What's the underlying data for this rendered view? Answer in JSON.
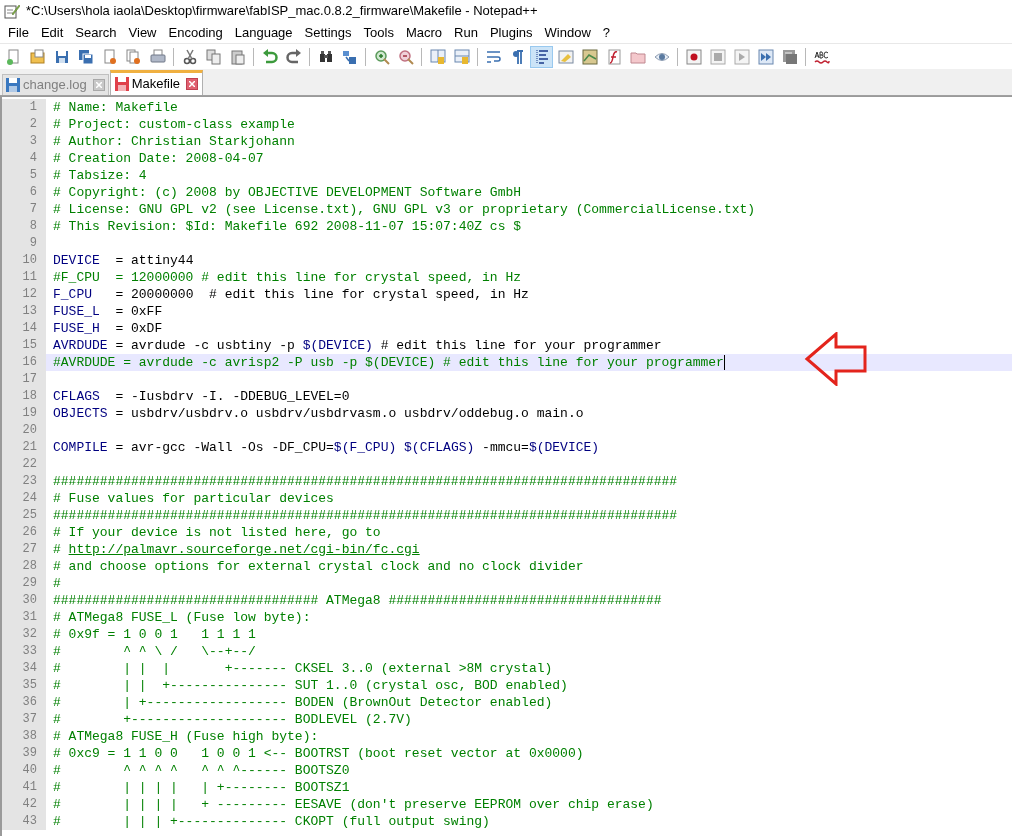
{
  "window": {
    "title": "*C:\\Users\\hola iaola\\Desktop\\firmware\\fabISP_mac.0.8.2_firmware\\Makefile - Notepad++"
  },
  "menu": [
    "File",
    "Edit",
    "Search",
    "View",
    "Encoding",
    "Language",
    "Settings",
    "Tools",
    "Macro",
    "Run",
    "Plugins",
    "Window",
    "?"
  ],
  "toolbar": [
    {
      "kind": "new",
      "selected": false
    },
    {
      "kind": "open",
      "selected": false
    },
    {
      "kind": "save",
      "selected": false
    },
    {
      "kind": "save-all",
      "selected": false
    },
    {
      "kind": "close",
      "selected": false
    },
    {
      "kind": "close-all",
      "selected": false
    },
    {
      "kind": "print",
      "selected": false
    },
    {
      "kind": "separator"
    },
    {
      "kind": "cut",
      "selected": false
    },
    {
      "kind": "copy",
      "selected": false
    },
    {
      "kind": "paste",
      "selected": false
    },
    {
      "kind": "separator"
    },
    {
      "kind": "undo",
      "selected": false
    },
    {
      "kind": "redo",
      "selected": false
    },
    {
      "kind": "separator"
    },
    {
      "kind": "find",
      "selected": false
    },
    {
      "kind": "replace",
      "selected": false
    },
    {
      "kind": "separator"
    },
    {
      "kind": "zoom-in",
      "selected": false
    },
    {
      "kind": "zoom-out",
      "selected": false
    },
    {
      "kind": "separator"
    },
    {
      "kind": "sync-vertical",
      "selected": false
    },
    {
      "kind": "sync-horizontal",
      "selected": false
    },
    {
      "kind": "separator"
    },
    {
      "kind": "wrap",
      "selected": false
    },
    {
      "kind": "pilcrow",
      "selected": false
    },
    {
      "kind": "indent-guide",
      "selected": true
    },
    {
      "kind": "language",
      "selected": false
    },
    {
      "kind": "map",
      "selected": false
    },
    {
      "kind": "function",
      "selected": false
    },
    {
      "kind": "folder",
      "selected": false
    },
    {
      "kind": "eye",
      "selected": false
    },
    {
      "kind": "separator"
    },
    {
      "kind": "record",
      "selected": false
    },
    {
      "kind": "stop",
      "selected": false
    },
    {
      "kind": "play",
      "selected": false
    },
    {
      "kind": "play-multiple",
      "selected": false
    },
    {
      "kind": "save-macro",
      "selected": false
    },
    {
      "kind": "separator"
    },
    {
      "kind": "spellcheck",
      "selected": false
    }
  ],
  "tabs": [
    {
      "label": "change.log",
      "selected": false,
      "modified": false
    },
    {
      "label": "Makefile",
      "selected": true,
      "modified": true
    }
  ],
  "editor": {
    "lines": [
      {
        "number": "1",
        "current": false,
        "segments": [
          {
            "kind": "comment",
            "text": "# Name: Makefile"
          }
        ]
      },
      {
        "number": "2",
        "current": false,
        "segments": [
          {
            "kind": "comment",
            "text": "# Project: custom-class example"
          }
        ]
      },
      {
        "number": "3",
        "current": false,
        "segments": [
          {
            "kind": "comment",
            "text": "# Author: Christian Starkjohann"
          }
        ]
      },
      {
        "number": "4",
        "current": false,
        "segments": [
          {
            "kind": "comment",
            "text": "# Creation Date: 2008-04-07"
          }
        ]
      },
      {
        "number": "5",
        "current": false,
        "segments": [
          {
            "kind": "comment",
            "text": "# Tabsize: 4"
          }
        ]
      },
      {
        "number": "6",
        "current": false,
        "segments": [
          {
            "kind": "comment",
            "text": "# Copyright: (c) 2008 by OBJECTIVE DEVELOPMENT Software GmbH"
          }
        ]
      },
      {
        "number": "7",
        "current": false,
        "segments": [
          {
            "kind": "comment",
            "text": "# License: GNU GPL v2 (see License.txt), GNU GPL v3 or proprietary (CommercialLicense.txt)"
          }
        ]
      },
      {
        "number": "8",
        "current": false,
        "segments": [
          {
            "kind": "comment",
            "text": "# This Revision: $Id: Makefile 692 2008-11-07 15:07:40Z cs $"
          }
        ]
      },
      {
        "number": "9",
        "current": false
      },
      {
        "number": "10",
        "current": false,
        "segments": [
          {
            "kind": "variable",
            "text": "DEVICE"
          },
          {
            "kind": "plain",
            "text": "  = attiny44"
          }
        ]
      },
      {
        "number": "11",
        "current": false,
        "segments": [
          {
            "kind": "comment",
            "text": "#F_CPU  = 12000000 # edit this line for crystal speed, in Hz"
          }
        ]
      },
      {
        "number": "12",
        "current": false,
        "segments": [
          {
            "kind": "variable",
            "text": "F_CPU"
          },
          {
            "kind": "plain",
            "text": "   = 20000000  # edit this line for crystal speed, in Hz"
          }
        ]
      },
      {
        "number": "13",
        "current": false,
        "segments": [
          {
            "kind": "variable",
            "text": "FUSE_L"
          },
          {
            "kind": "plain",
            "text": "  = 0xFF"
          }
        ]
      },
      {
        "number": "14",
        "current": false,
        "segments": [
          {
            "kind": "variable",
            "text": "FUSE_H"
          },
          {
            "kind": "plain",
            "text": "  = 0xDF"
          }
        ]
      },
      {
        "number": "15",
        "current": false,
        "segments": [
          {
            "kind": "variable",
            "text": "AVRDUDE"
          },
          {
            "kind": "plain",
            "text": " = avrdude -c usbtiny -p "
          },
          {
            "kind": "variable",
            "text": "$(DEVICE)"
          },
          {
            "kind": "plain",
            "text": " # edit this line for your programmer"
          }
        ]
      },
      {
        "number": "16",
        "current": true,
        "segments": [
          {
            "kind": "comment",
            "text": "#AVRDUDE = avrdude -c avrisp2 -P usb -p $(DEVICE) # edit this line for your programmer"
          }
        ]
      },
      {
        "number": "17",
        "current": false
      },
      {
        "number": "18",
        "current": false,
        "segments": [
          {
            "kind": "variable",
            "text": "CFLAGS"
          },
          {
            "kind": "plain",
            "text": "  = -Iusbdrv -I. -DDEBUG_LEVEL=0"
          }
        ]
      },
      {
        "number": "19",
        "current": false,
        "segments": [
          {
            "kind": "variable",
            "text": "OBJECTS"
          },
          {
            "kind": "plain",
            "text": " = usbdrv/usbdrv.o usbdrv/usbdrvasm.o usbdrv/oddebug.o main.o"
          }
        ]
      },
      {
        "number": "20",
        "current": false
      },
      {
        "number": "21",
        "current": false,
        "segments": [
          {
            "kind": "variable",
            "text": "COMPILE"
          },
          {
            "kind": "plain",
            "text": " = avr-gcc -Wall -Os -DF_CPU="
          },
          {
            "kind": "variable",
            "text": "$(F_CPU) $(CFLAGS)"
          },
          {
            "kind": "plain",
            "text": " -mmcu="
          },
          {
            "kind": "variable",
            "text": "$(DEVICE)"
          }
        ]
      },
      {
        "number": "22",
        "current": false
      },
      {
        "number": "23",
        "current": false,
        "segments": [
          {
            "kind": "comment",
            "text": "################################################################################"
          }
        ]
      },
      {
        "number": "24",
        "current": false,
        "segments": [
          {
            "kind": "comment",
            "text": "# Fuse values for particular devices"
          }
        ]
      },
      {
        "number": "25",
        "current": false,
        "segments": [
          {
            "kind": "comment",
            "text": "################################################################################"
          }
        ]
      },
      {
        "number": "26",
        "current": false,
        "segments": [
          {
            "kind": "comment",
            "text": "# If your device is not listed here, go to"
          }
        ]
      },
      {
        "number": "27",
        "current": false,
        "segments": [
          {
            "kind": "comment",
            "text": "# "
          },
          {
            "kind": "link",
            "text": "http://palmavr.sourceforge.net/cgi-bin/fc.cgi"
          }
        ]
      },
      {
        "number": "28",
        "current": false,
        "segments": [
          {
            "kind": "comment",
            "text": "# and choose options for external crystal clock and no clock divider"
          }
        ]
      },
      {
        "number": "29",
        "current": false,
        "segments": [
          {
            "kind": "comment",
            "text": "#"
          }
        ]
      },
      {
        "number": "30",
        "current": false,
        "segments": [
          {
            "kind": "comment",
            "text": "################################## ATMega8 ###################################"
          }
        ]
      },
      {
        "number": "31",
        "current": false,
        "segments": [
          {
            "kind": "comment",
            "text": "# ATMega8 FUSE_L (Fuse low byte):"
          }
        ]
      },
      {
        "number": "32",
        "current": false,
        "segments": [
          {
            "kind": "comment",
            "text": "# 0x9f = 1 0 0 1   1 1 1 1"
          }
        ]
      },
      {
        "number": "33",
        "current": false,
        "segments": [
          {
            "kind": "comment",
            "text": "#        ^ ^ \\ /   \\--+--/"
          }
        ]
      },
      {
        "number": "34",
        "current": false,
        "segments": [
          {
            "kind": "comment",
            "text": "#        | |  |       +------- CKSEL 3..0 (external >8M crystal)"
          }
        ]
      },
      {
        "number": "35",
        "current": false,
        "segments": [
          {
            "kind": "comment",
            "text": "#        | |  +--------------- SUT 1..0 (crystal osc, BOD enabled)"
          }
        ]
      },
      {
        "number": "36",
        "current": false,
        "segments": [
          {
            "kind": "comment",
            "text": "#        | +------------------ BODEN (BrownOut Detector enabled)"
          }
        ]
      },
      {
        "number": "37",
        "current": false,
        "segments": [
          {
            "kind": "comment",
            "text": "#        +-------------------- BODLEVEL (2.7V)"
          }
        ]
      },
      {
        "number": "38",
        "current": false,
        "segments": [
          {
            "kind": "comment",
            "text": "# ATMega8 FUSE_H (Fuse high byte):"
          }
        ]
      },
      {
        "number": "39",
        "current": false,
        "segments": [
          {
            "kind": "comment",
            "text": "# 0xc9 = 1 1 0 0   1 0 0 1 <-- BOOTRST (boot reset vector at 0x0000)"
          }
        ]
      },
      {
        "number": "40",
        "current": false,
        "segments": [
          {
            "kind": "comment",
            "text": "#        ^ ^ ^ ^   ^ ^ ^------ BOOTSZ0"
          }
        ]
      },
      {
        "number": "41",
        "current": false,
        "segments": [
          {
            "kind": "comment",
            "text": "#        | | | |   | +-------- BOOTSZ1"
          }
        ]
      },
      {
        "number": "42",
        "current": false,
        "segments": [
          {
            "kind": "comment",
            "text": "#        | | | |   + --------- EESAVE (don't preserve EEPROM over chip erase)"
          }
        ]
      },
      {
        "number": "43",
        "current": false,
        "segments": [
          {
            "kind": "comment",
            "text": "#        | | | +-------------- CKOPT (full output swing)"
          }
        ]
      }
    ]
  }
}
